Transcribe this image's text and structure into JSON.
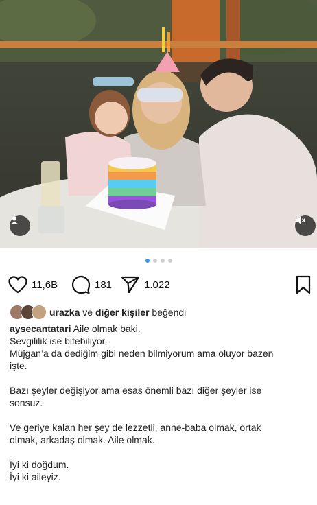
{
  "post": {
    "media_alt_icons": {
      "user_tag": "person-icon",
      "mute": "speaker-muted-icon"
    },
    "carousel": {
      "count": 4,
      "active": 0
    },
    "stats": {
      "likes": "11,6B",
      "comments": "181",
      "shares": "1.022"
    },
    "liked_by": {
      "name": "urazka",
      "connector": "ve",
      "others": "diğer kişiler",
      "suffix": "beğendi"
    },
    "caption": {
      "username": "aysecantatari",
      "first_line": "Aile olmak baki.",
      "paragraphs": [
        [
          "Sevgililik ise bitebiliyor.",
          "Müjgan’a da dediğim gibi neden bilmiyorum ama oluyor bazen",
          "işte."
        ],
        [
          "Bazı şeyler değişiyor ama esas önemli bazı diğer şeyler ise",
          "sonsuz."
        ],
        [
          "Ve geriye kalan her şey de lezzetli, anne-baba olmak, ortak",
          "olmak, arkadaş olmak. Aile olmak."
        ],
        [
          "İyi ki doğdum.",
          "İyi ki aileyiz."
        ]
      ]
    }
  },
  "colors": {
    "accent_dot": "#3897f0",
    "text": "#222222"
  }
}
